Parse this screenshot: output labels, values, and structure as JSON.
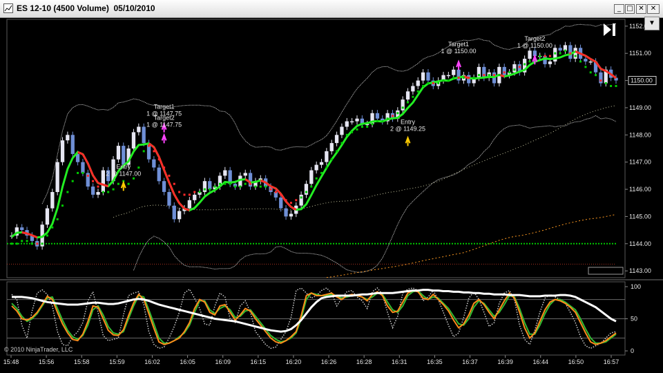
{
  "window": {
    "title": "ES 12-10 (4500 Volume)  05/10/2010",
    "minimize_glyph": "_",
    "maximize_glyph": "□",
    "close_glyph": "✕",
    "dropdown_glyph": "▼",
    "skip_to_end_icon": "skip-to-end-icon"
  },
  "copyright": "© 2010 NinjaTrader, LLC",
  "colors": {
    "background": "#000000",
    "up_candle": "#e6e6f2",
    "down_candle": "#6f8fd6",
    "stop_long": "#00cc00",
    "stop_short": "#ff2a2a",
    "hma": "#22ee22",
    "bollinger": "#cfcfcf",
    "ma_slow": "#c8c8a0",
    "ma_orange": "#ff9a22",
    "dotted_green": "#00cc00",
    "dotted_red": "#aa3322",
    "marker_arrow": "#ffcc00",
    "target_arrow": "#ff44ff",
    "stoch_orange": "#ff8c1a",
    "stoch_green": "#33bb33",
    "stoch_dots": "#cfcfcf",
    "stoch_white": "#ffffff"
  },
  "chart_data": [
    {
      "type": "candlestick",
      "title": "ES 12-10 (4500 Volume)  05/10/2010",
      "ylim": [
        1142.75,
        1152.25
      ],
      "y_ticks": [
        "1143.00",
        "1144.00",
        "1145.00",
        "1146.00",
        "1147.00",
        "1148.00",
        "1149.00",
        "1150.00",
        "1151.00",
        "1152.00"
      ],
      "last_price_label": "1150.00",
      "x_labels": [
        "15:48",
        "15:56",
        "15:58",
        "15:59",
        "16:02",
        "16:05",
        "16:09",
        "16:15",
        "16:20",
        "16:26",
        "16:28",
        "16:31",
        "16:35",
        "16:37",
        "16:39",
        "16:44",
        "16:50",
        "16:57"
      ],
      "bars_open": [
        1144.3,
        1144.3,
        1144.6,
        1144.5,
        1144.3,
        1144.1,
        1143.9,
        1144.7,
        1145.3,
        1145.9,
        1147.0,
        1147.8,
        1148.0,
        1147.3,
        1147.0,
        1146.6,
        1146.1,
        1145.8,
        1145.9,
        1146.7,
        1146.3,
        1147.1,
        1147.6,
        1146.9,
        1147.5,
        1148.1,
        1148.3,
        1147.7,
        1147.1,
        1146.8,
        1146.3,
        1145.9,
        1145.4,
        1144.9,
        1145.2,
        1145.3,
        1145.6,
        1145.8,
        1145.9,
        1146.3,
        1146.0,
        1146.1,
        1146.5,
        1146.7,
        1146.2,
        1146.1,
        1146.5,
        1146.6,
        1146.1,
        1146.3,
        1146.4,
        1146.1,
        1145.9,
        1145.7,
        1145.3,
        1145.0,
        1145.1,
        1145.4,
        1145.8,
        1146.2,
        1146.7,
        1146.9,
        1147.0,
        1147.4,
        1147.7,
        1148.0,
        1148.3,
        1148.5,
        1148.5,
        1148.6,
        1148.4,
        1148.4,
        1148.8,
        1148.6,
        1148.5,
        1148.8,
        1148.6,
        1148.9,
        1149.3,
        1149.6,
        1149.8,
        1150.0,
        1150.3,
        1150.0,
        1149.8,
        1150.0,
        1150.2,
        1150.2,
        1150.4,
        1150.0,
        1150.2,
        1149.9,
        1150.1,
        1150.5,
        1150.1,
        1150.3,
        1149.9,
        1150.5,
        1150.2,
        1150.3,
        1150.6,
        1150.3,
        1150.8,
        1151.1,
        1150.9,
        1150.9,
        1150.6,
        1150.7,
        1151.2,
        1151.1,
        1151.3,
        1150.8,
        1151.2,
        1150.8,
        1150.7,
        1150.7,
        1150.3,
        1149.9,
        1150.4,
        1150.1
      ],
      "bars_close": [
        1144.3,
        1144.6,
        1144.5,
        1144.3,
        1144.1,
        1143.9,
        1144.7,
        1145.3,
        1145.9,
        1147.0,
        1147.8,
        1148.0,
        1147.3,
        1147.0,
        1146.6,
        1146.1,
        1145.8,
        1145.9,
        1146.7,
        1146.3,
        1147.1,
        1147.6,
        1146.9,
        1147.5,
        1148.1,
        1148.3,
        1147.7,
        1147.1,
        1146.8,
        1146.3,
        1145.9,
        1145.4,
        1144.9,
        1145.2,
        1145.3,
        1145.6,
        1145.8,
        1145.9,
        1146.3,
        1146.0,
        1146.1,
        1146.5,
        1146.7,
        1146.2,
        1146.1,
        1146.5,
        1146.6,
        1146.1,
        1146.3,
        1146.4,
        1146.1,
        1145.9,
        1145.7,
        1145.3,
        1145.0,
        1145.1,
        1145.4,
        1145.8,
        1146.2,
        1146.7,
        1146.9,
        1147.0,
        1147.4,
        1147.7,
        1148.0,
        1148.3,
        1148.5,
        1148.5,
        1148.6,
        1148.4,
        1148.4,
        1148.8,
        1148.6,
        1148.5,
        1148.8,
        1148.6,
        1148.9,
        1149.3,
        1149.6,
        1149.8,
        1150.0,
        1150.3,
        1150.0,
        1149.8,
        1150.0,
        1150.2,
        1150.2,
        1150.4,
        1150.0,
        1150.2,
        1149.9,
        1150.1,
        1150.5,
        1150.1,
        1150.3,
        1149.9,
        1150.5,
        1150.2,
        1150.3,
        1150.6,
        1150.3,
        1150.8,
        1151.1,
        1150.9,
        1150.9,
        1150.6,
        1150.7,
        1151.2,
        1151.1,
        1151.3,
        1150.8,
        1151.2,
        1150.8,
        1150.7,
        1150.7,
        1150.3,
        1149.9,
        1150.4,
        1150.1,
        1150.0
      ],
      "stop_dots": [
        1144.0,
        1144.0,
        1144.1,
        1144.1,
        1144.0,
        1144.0,
        1144.0,
        1144.3,
        1144.6,
        1144.9,
        1145.4,
        1145.9,
        1146.3,
        1146.6,
        1146.6,
        1146.5,
        1146.3,
        1146.1,
        1145.9,
        1145.9,
        1146.0,
        1146.2,
        1146.3,
        1146.2,
        1146.4,
        1146.8,
        1147.4,
        1147.6,
        1147.4,
        1147.1,
        1146.8,
        1146.5,
        1146.2,
        1145.9,
        1145.8,
        1145.8,
        1145.9,
        1145.9,
        1146.0,
        1146.0,
        1146.1,
        1146.2,
        1146.2,
        1146.2,
        1146.1,
        1146.1,
        1146.2,
        1146.2,
        1146.1,
        1146.1,
        1146.1,
        1146.0,
        1145.9,
        1145.8,
        1145.6,
        1145.5,
        1145.6,
        1145.7,
        1145.9,
        1146.1,
        1146.4,
        1146.6,
        1146.8,
        1147.1,
        1147.4,
        1147.7,
        1148.0,
        1148.1,
        1148.2,
        1148.3,
        1148.3,
        1148.4,
        1148.5,
        1148.5,
        1148.6,
        1148.7,
        1148.8,
        1149.0,
        1149.2,
        1149.4,
        1149.6,
        1149.8,
        1149.9,
        1149.9,
        1149.9,
        1150.0,
        1150.0,
        1150.1,
        1150.1,
        1150.1,
        1150.1,
        1150.1,
        1150.2,
        1150.2,
        1150.2,
        1150.2,
        1150.2,
        1150.3,
        1150.3,
        1150.4,
        1150.5,
        1150.6,
        1150.7,
        1150.8,
        1150.9,
        1150.9,
        1150.9,
        1151.0,
        1151.0,
        1151.1,
        1151.0,
        1150.9,
        1150.7,
        1150.5,
        1150.3,
        1150.2,
        1150.0,
        1149.9,
        1149.8,
        1149.8
      ],
      "annotations": [
        {
          "label": "Entry",
          "detail": "2 @ 1147.00",
          "price": 1146.35,
          "index": 22
        },
        {
          "label": "Target1",
          "detail": "1 @ 1147.75",
          "price": 1148.55,
          "index": 30
        },
        {
          "label": "Target2",
          "detail": "1 @ 1147.75",
          "price": 1148.15,
          "index": 30
        },
        {
          "label": "Entry",
          "detail": "2 @ 1149.25",
          "price": 1148.0,
          "index": 78
        },
        {
          "label": "Target1",
          "detail": "1 @ 1150.00",
          "price": 1150.85,
          "index": 88
        },
        {
          "label": "Target2",
          "detail": "1 @ 1150.00",
          "price": 1151.05,
          "index": 103
        }
      ]
    },
    {
      "type": "line",
      "ylim": [
        0,
        100
      ],
      "y_ticks": [
        "0",
        "50",
        "100"
      ],
      "series_orange": [
        70,
        62,
        50,
        48,
        52,
        60,
        72,
        85,
        80,
        60,
        42,
        28,
        18,
        16,
        26,
        46,
        70,
        68,
        50,
        32,
        25,
        24,
        33,
        55,
        75,
        88,
        80,
        58,
        35,
        14,
        10,
        12,
        16,
        20,
        30,
        44,
        66,
        80,
        76,
        60,
        56,
        70,
        72,
        60,
        48,
        56,
        66,
        62,
        50,
        40,
        30,
        20,
        14,
        12,
        16,
        22,
        30,
        55,
        86,
        90,
        86,
        86,
        88,
        90,
        84,
        80,
        86,
        88,
        86,
        84,
        78,
        88,
        92,
        86,
        70,
        60,
        62,
        76,
        90,
        94,
        92,
        82,
        80,
        88,
        80,
        72,
        62,
        48,
        36,
        42,
        56,
        74,
        80,
        72,
        60,
        50,
        64,
        78,
        90,
        82,
        60,
        36,
        20,
        28,
        46,
        64,
        76,
        80,
        78,
        74,
        68,
        60,
        44,
        28,
        14,
        10,
        12,
        16,
        22,
        28
      ],
      "series_green": [
        74,
        66,
        54,
        46,
        50,
        58,
        70,
        82,
        84,
        66,
        48,
        32,
        22,
        18,
        24,
        40,
        64,
        70,
        56,
        38,
        28,
        26,
        30,
        50,
        70,
        86,
        84,
        64,
        42,
        20,
        12,
        12,
        16,
        22,
        28,
        40,
        60,
        78,
        78,
        64,
        58,
        66,
        70,
        64,
        52,
        54,
        62,
        64,
        54,
        44,
        34,
        24,
        18,
        14,
        16,
        20,
        28,
        50,
        80,
        90,
        88,
        86,
        86,
        88,
        86,
        82,
        84,
        86,
        86,
        84,
        80,
        84,
        90,
        88,
        76,
        64,
        60,
        70,
        86,
        92,
        94,
        86,
        80,
        84,
        82,
        74,
        66,
        54,
        42,
        40,
        50,
        68,
        78,
        74,
        64,
        54,
        60,
        72,
        86,
        84,
        66,
        44,
        26,
        26,
        40,
        58,
        72,
        80,
        80,
        76,
        70,
        64,
        50,
        34,
        20,
        12,
        12,
        14,
        20,
        26
      ],
      "series_dots": [
        88,
        80,
        40,
        20,
        62,
        90,
        95,
        88,
        70,
        30,
        10,
        8,
        22,
        30,
        44,
        78,
        92,
        60,
        24,
        16,
        18,
        20,
        56,
        86,
        90,
        92,
        72,
        30,
        10,
        4,
        6,
        20,
        38,
        60,
        90,
        96,
        82,
        66,
        42,
        40,
        70,
        90,
        84,
        50,
        44,
        70,
        78,
        60,
        30,
        20,
        10,
        4,
        6,
        18,
        30,
        52,
        94,
        98,
        90,
        82,
        86,
        94,
        98,
        90,
        70,
        82,
        92,
        94,
        84,
        78,
        66,
        92,
        98,
        88,
        60,
        36,
        54,
        90,
        96,
        98,
        94,
        78,
        84,
        94,
        80,
        60,
        40,
        22,
        28,
        52,
        82,
        92,
        80,
        60,
        38,
        44,
        74,
        90,
        94,
        80,
        40,
        18,
        10,
        32,
        60,
        82,
        88,
        84,
        80,
        74,
        60,
        44,
        22,
        8,
        4,
        8,
        12,
        20,
        28,
        30
      ],
      "series_white": [
        84,
        84,
        84,
        83,
        82,
        80,
        78,
        76,
        75,
        74,
        73,
        72,
        72,
        72,
        73,
        74,
        75,
        75,
        74,
        73,
        73,
        74,
        76,
        78,
        80,
        81,
        80,
        78,
        75,
        72,
        70,
        68,
        66,
        64,
        62,
        60,
        58,
        56,
        54,
        52,
        50,
        49,
        48,
        47,
        46,
        44,
        42,
        40,
        38,
        36,
        34,
        32,
        31,
        30,
        31,
        34,
        40,
        48,
        58,
        68,
        76,
        82,
        84,
        85,
        86,
        86,
        86,
        86,
        87,
        88,
        88,
        89,
        90,
        90,
        90,
        90,
        91,
        92,
        93,
        94,
        94,
        95,
        95,
        94,
        94,
        93,
        93,
        92,
        92,
        91,
        91,
        90,
        90,
        89,
        89,
        88,
        88,
        88,
        87,
        87,
        87,
        86,
        85,
        85,
        85,
        86,
        86,
        86,
        87,
        87,
        86,
        84,
        80,
        76,
        72,
        68,
        62,
        56,
        50,
        46
      ],
      "reference_lines": [
        80,
        50,
        20
      ]
    }
  ]
}
